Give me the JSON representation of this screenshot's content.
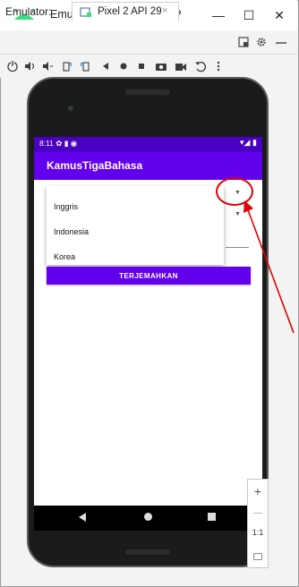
{
  "window": {
    "title": "Emulator - KamusApp_NP",
    "minimize": "—",
    "maximize": "☐",
    "close": "✕"
  },
  "tabs": {
    "emulator_label": "Emulator:",
    "device_tab": "Pixel 2 API 29",
    "tab_close": "×",
    "right_icons": [
      "window-icon",
      "gear-icon",
      "minus-icon"
    ]
  },
  "toolbar": {
    "icons": [
      "power-icon",
      "volume-up-icon",
      "volume-down-icon",
      "rotate-left-icon",
      "rotate-right-icon",
      "back-icon",
      "home-icon",
      "overview-icon",
      "camera-icon",
      "video-icon",
      "undo-icon",
      "more-icon"
    ]
  },
  "phone": {
    "status_time": "8:11 ✿ ▮ ◉",
    "status_icons": "▾◢ ▮",
    "app_title": "KamusTigaBahasa",
    "dropdown_options": [
      "Inggris",
      "Indonesia",
      "Korea"
    ],
    "translate_button": "TERJEMAHKAN"
  },
  "zoom": {
    "plus": "+",
    "minus": "—",
    "ratio": "1:1"
  },
  "colors": {
    "status_bar": "#4a00c0",
    "app_bar": "#6200ee",
    "annotation": "#e00000"
  }
}
